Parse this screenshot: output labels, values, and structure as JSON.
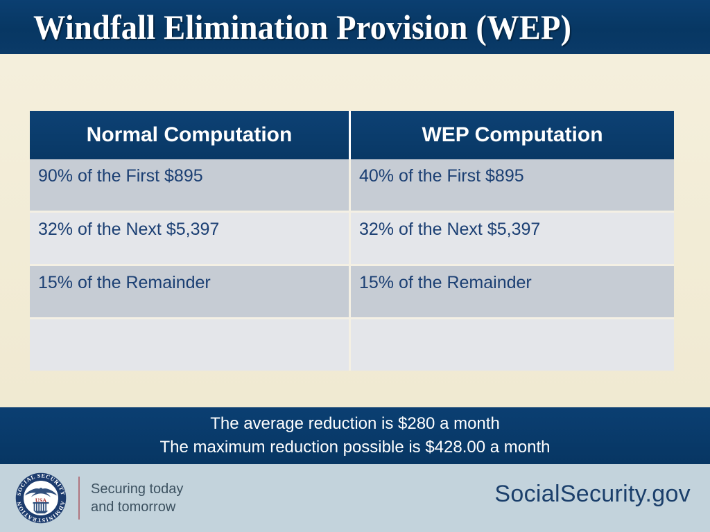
{
  "slide": {
    "title": "Windfall Elimination Provision (WEP)",
    "background_color": "#f2ecd6",
    "accent_color": "#0a3a68"
  },
  "table": {
    "headers": [
      "Normal Computation",
      "WEP Computation"
    ],
    "rows": [
      [
        "90% of the First $895",
        "40% of the First $895"
      ],
      [
        "32% of the Next $5,397",
        "32% of the Next $5,397"
      ],
      [
        "15% of the Remainder",
        "15% of the Remainder"
      ],
      [
        "",
        ""
      ]
    ]
  },
  "message": {
    "line1": "The average reduction is $280 a month",
    "line2": "The maximum reduction possible is $428.00 a month"
  },
  "footer": {
    "seal_outer_text_top": "SOCIAL SECURITY",
    "seal_outer_text_bottom": "ADMINISTRATION",
    "seal_shield_text": "USA",
    "tagline_line1": "Securing today",
    "tagline_line2": "and tomorrow",
    "site": "SocialSecurity.gov"
  }
}
